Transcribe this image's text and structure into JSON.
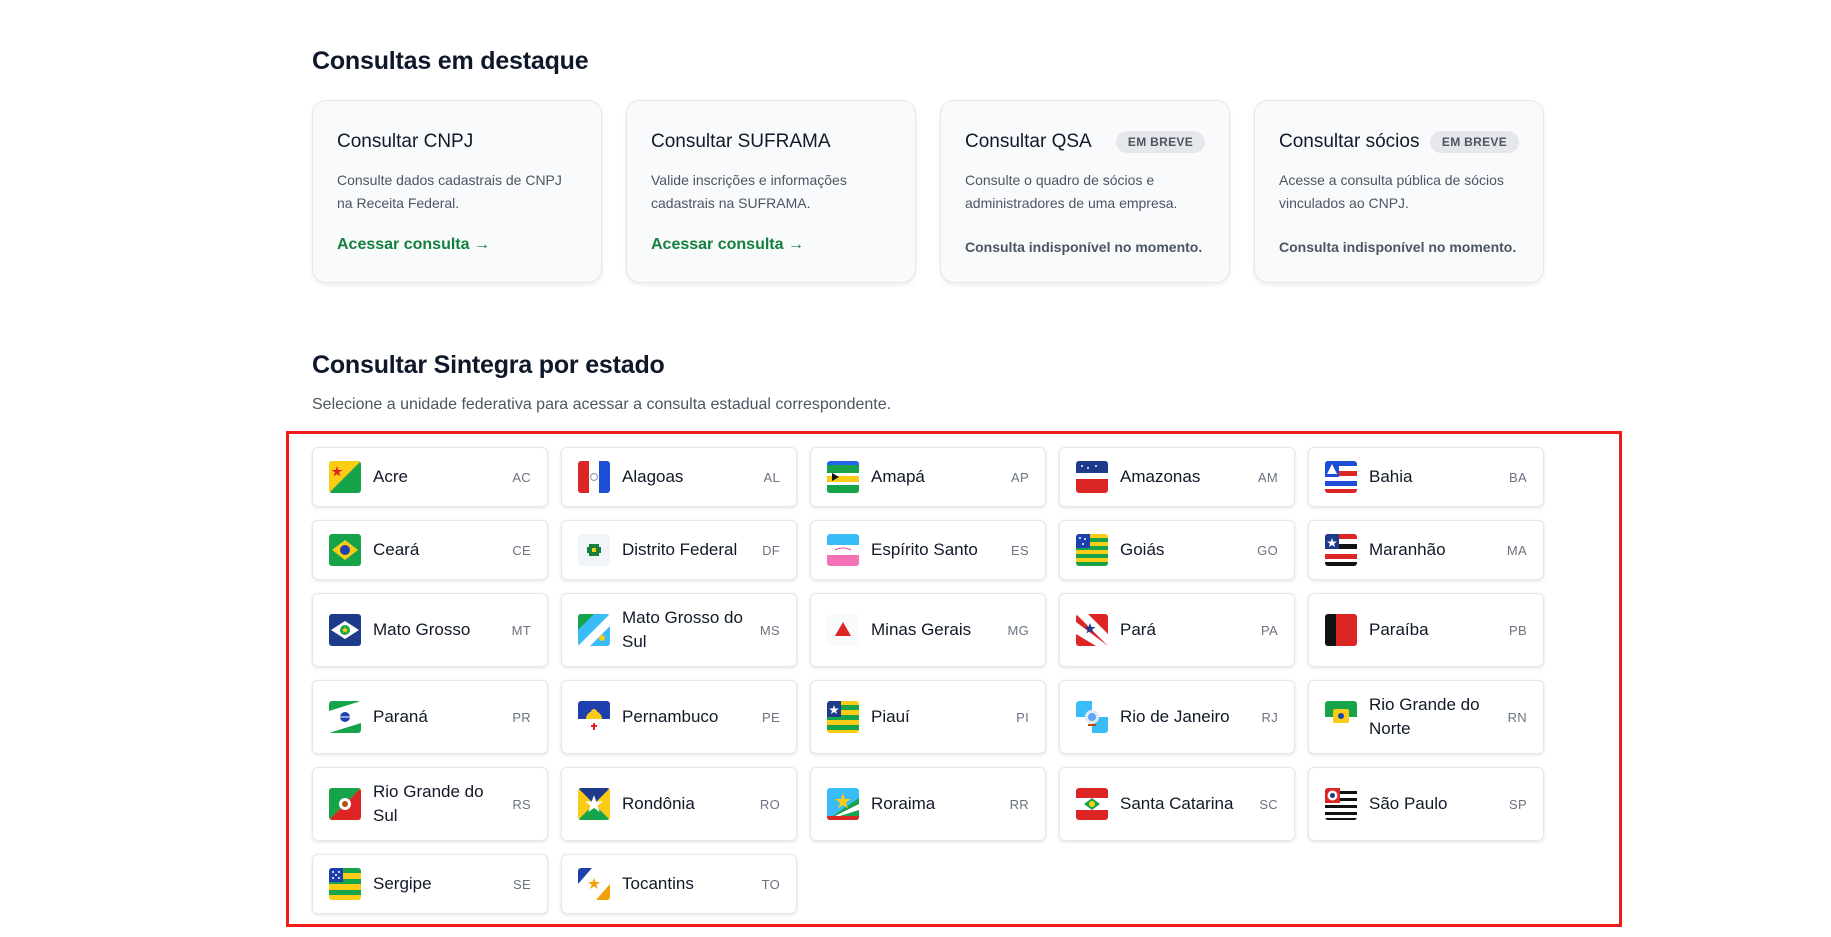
{
  "featured": {
    "title": "Consultas em destaque",
    "cards": [
      {
        "title": "Consultar CNPJ",
        "desc": "Consulte dados cadastrais de CNPJ na Receita Federal.",
        "link": "Acessar consulta →"
      },
      {
        "title": "Consultar SUFRAMA",
        "desc": "Valide inscrições e informações cadastrais na SUFRAMA.",
        "link": "Acessar consulta →"
      },
      {
        "title": "Consultar QSA",
        "badge": "EM BREVE",
        "desc": "Consulte o quadro de sócios e administradores de uma empresa.",
        "status": "Consulta indisponível no momento."
      },
      {
        "title": "Consultar sócios",
        "badge": "EM BREVE",
        "desc": "Acesse a consulta pública de sócios vinculados ao CNPJ.",
        "status": "Consulta indisponível no momento."
      }
    ]
  },
  "sintegra": {
    "title": "Consultar Sintegra por estado",
    "subtitle": "Selecione a unidade federativa para acessar a consulta estadual correspondente.",
    "states": [
      {
        "name": "Acre",
        "code": "AC"
      },
      {
        "name": "Alagoas",
        "code": "AL"
      },
      {
        "name": "Amapá",
        "code": "AP"
      },
      {
        "name": "Amazonas",
        "code": "AM"
      },
      {
        "name": "Bahia",
        "code": "BA"
      },
      {
        "name": "Ceará",
        "code": "CE"
      },
      {
        "name": "Distrito Federal",
        "code": "DF"
      },
      {
        "name": "Espírito Santo",
        "code": "ES"
      },
      {
        "name": "Goiás",
        "code": "GO"
      },
      {
        "name": "Maranhão",
        "code": "MA"
      },
      {
        "name": "Mato Grosso",
        "code": "MT"
      },
      {
        "name": "Mato Grosso do Sul",
        "code": "MS"
      },
      {
        "name": "Minas Gerais",
        "code": "MG"
      },
      {
        "name": "Pará",
        "code": "PA"
      },
      {
        "name": "Paraíba",
        "code": "PB"
      },
      {
        "name": "Paraná",
        "code": "PR"
      },
      {
        "name": "Pernambuco",
        "code": "PE"
      },
      {
        "name": "Piauí",
        "code": "PI"
      },
      {
        "name": "Rio de Janeiro",
        "code": "RJ"
      },
      {
        "name": "Rio Grande do Norte",
        "code": "RN"
      },
      {
        "name": "Rio Grande do Sul",
        "code": "RS"
      },
      {
        "name": "Rondônia",
        "code": "RO"
      },
      {
        "name": "Roraima",
        "code": "RR"
      },
      {
        "name": "Santa Catarina",
        "code": "SC"
      },
      {
        "name": "São Paulo",
        "code": "SP"
      },
      {
        "name": "Sergipe",
        "code": "SE"
      },
      {
        "name": "Tocantins",
        "code": "TO"
      }
    ]
  },
  "colors": {
    "link": "#15803d",
    "highlight": "#ef1c1c"
  }
}
